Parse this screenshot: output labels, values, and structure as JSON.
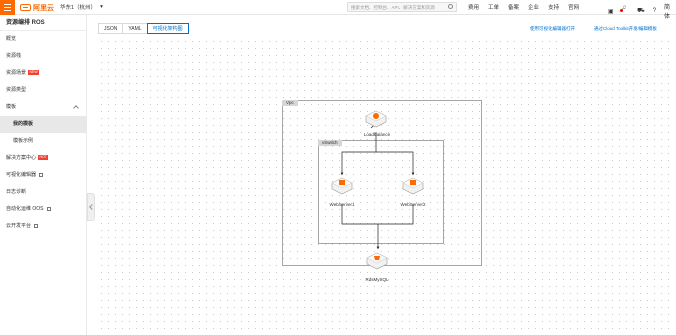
{
  "topbar": {
    "logo_text": "阿里云",
    "region": "华东1（杭州）",
    "search_placeholder": "搜索文档、控制台、API、解决方案和资源",
    "nav": [
      "费用",
      "工单",
      "备案",
      "企业",
      "支持",
      "官网"
    ],
    "lang": "简体",
    "brand_color": "#ff6a00"
  },
  "sidebar": {
    "title": "资源编排 ROS",
    "items": [
      {
        "label": "概览",
        "hot": "",
        "ext": false,
        "sub": false,
        "active": false
      },
      {
        "label": "资源栈",
        "hot": "",
        "ext": false,
        "sub": false,
        "active": false
      },
      {
        "label": "资源场景",
        "hot": "NEW",
        "ext": false,
        "sub": false,
        "active": false
      },
      {
        "label": "资源类型",
        "hot": "",
        "ext": false,
        "sub": false,
        "active": false
      },
      {
        "label": "模板",
        "hot": "",
        "ext": false,
        "sub": false,
        "active": false,
        "expandable": true
      },
      {
        "label": "我的模板",
        "hot": "",
        "ext": false,
        "sub": true,
        "active": true
      },
      {
        "label": "模板示例",
        "hot": "",
        "ext": false,
        "sub": true,
        "active": false
      },
      {
        "label": "解决方案中心",
        "hot": "HOT",
        "ext": false,
        "sub": false,
        "active": false
      },
      {
        "label": "可视化编辑器",
        "hot": "",
        "ext": true,
        "sub": false,
        "active": false
      },
      {
        "label": "日志诊断",
        "hot": "",
        "ext": false,
        "sub": false,
        "active": false
      },
      {
        "label": "自动化运维 OOS",
        "hot": "",
        "ext": true,
        "sub": false,
        "active": false
      },
      {
        "label": "云开发平台",
        "hot": "",
        "ext": true,
        "sub": false,
        "active": false
      }
    ]
  },
  "tabs": [
    {
      "label": "JSON",
      "active": false
    },
    {
      "label": "YAML",
      "active": false
    },
    {
      "label": "可视化架构图",
      "active": true
    }
  ],
  "links": {
    "open_editor": "使用可视化编辑器打开",
    "cloud_toolkit": "通过Cloud Toolkit开发/编辑模板"
  },
  "diagram": {
    "vpc_label": "Vpc",
    "vswitch_label": "vSwitch",
    "nodes": {
      "load_balance": "LoadBalance",
      "web_server_1": "WebServer1",
      "web_server_2": "WebServer2",
      "rds": "RdsMySQL"
    }
  }
}
